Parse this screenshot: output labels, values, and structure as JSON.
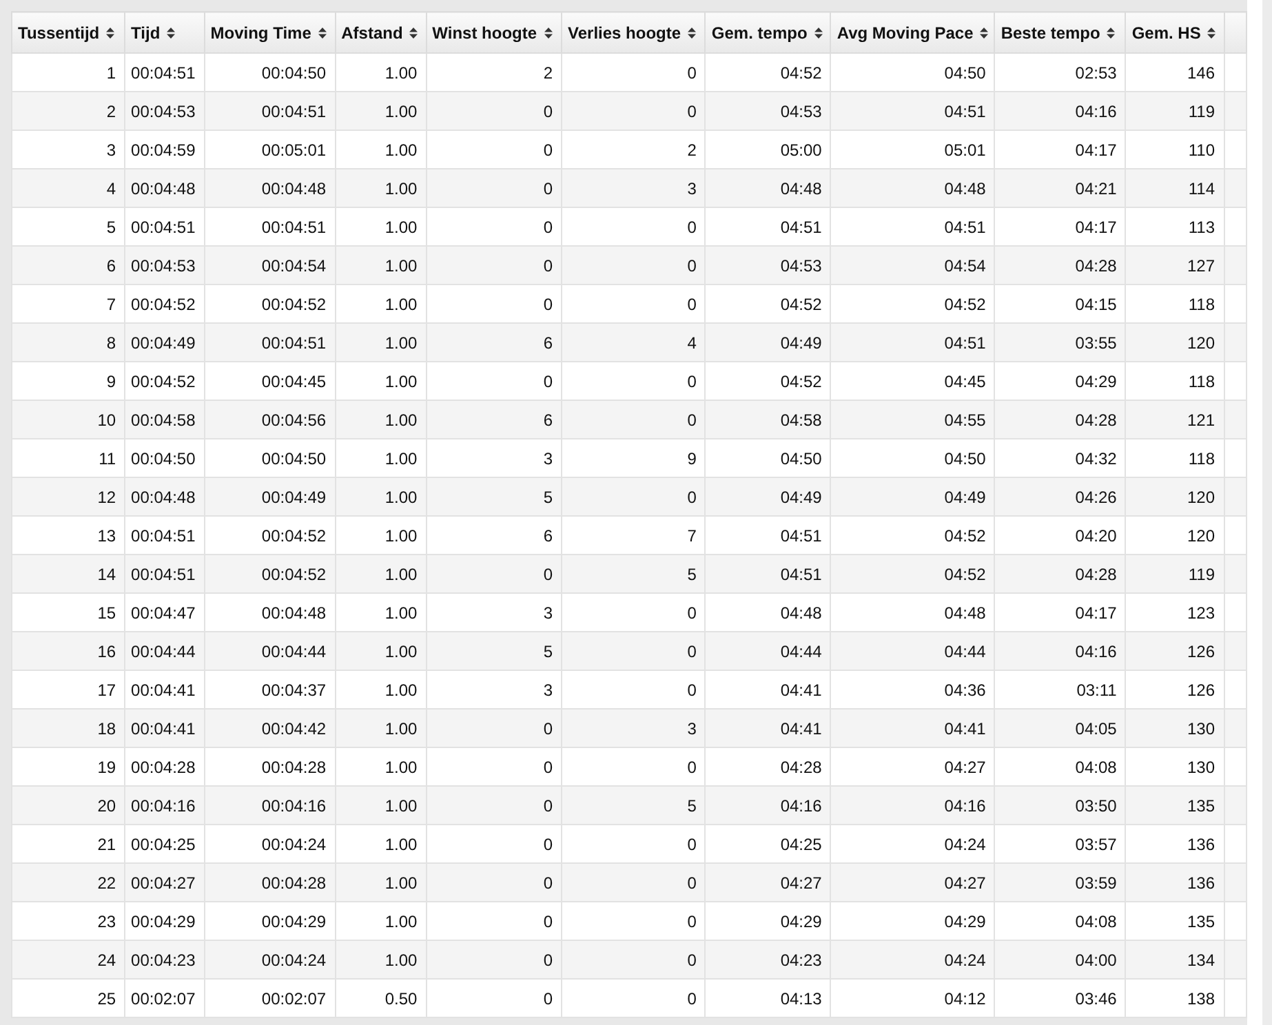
{
  "table": {
    "columns": [
      "Tussentijd",
      "Tijd",
      "Moving Time",
      "Afstand",
      "Winst hoogte",
      "Verlies hoogte",
      "Gem. tempo",
      "Avg Moving Pace",
      "Beste tempo",
      "Gem. HS"
    ],
    "rows": [
      [
        "1",
        "00:04:51",
        "00:04:50",
        "1.00",
        "2",
        "0",
        "04:52",
        "04:50",
        "02:53",
        "146"
      ],
      [
        "2",
        "00:04:53",
        "00:04:51",
        "1.00",
        "0",
        "0",
        "04:53",
        "04:51",
        "04:16",
        "119"
      ],
      [
        "3",
        "00:04:59",
        "00:05:01",
        "1.00",
        "0",
        "2",
        "05:00",
        "05:01",
        "04:17",
        "110"
      ],
      [
        "4",
        "00:04:48",
        "00:04:48",
        "1.00",
        "0",
        "3",
        "04:48",
        "04:48",
        "04:21",
        "114"
      ],
      [
        "5",
        "00:04:51",
        "00:04:51",
        "1.00",
        "0",
        "0",
        "04:51",
        "04:51",
        "04:17",
        "113"
      ],
      [
        "6",
        "00:04:53",
        "00:04:54",
        "1.00",
        "0",
        "0",
        "04:53",
        "04:54",
        "04:28",
        "127"
      ],
      [
        "7",
        "00:04:52",
        "00:04:52",
        "1.00",
        "0",
        "0",
        "04:52",
        "04:52",
        "04:15",
        "118"
      ],
      [
        "8",
        "00:04:49",
        "00:04:51",
        "1.00",
        "6",
        "4",
        "04:49",
        "04:51",
        "03:55",
        "120"
      ],
      [
        "9",
        "00:04:52",
        "00:04:45",
        "1.00",
        "0",
        "0",
        "04:52",
        "04:45",
        "04:29",
        "118"
      ],
      [
        "10",
        "00:04:58",
        "00:04:56",
        "1.00",
        "6",
        "0",
        "04:58",
        "04:55",
        "04:28",
        "121"
      ],
      [
        "11",
        "00:04:50",
        "00:04:50",
        "1.00",
        "3",
        "9",
        "04:50",
        "04:50",
        "04:32",
        "118"
      ],
      [
        "12",
        "00:04:48",
        "00:04:49",
        "1.00",
        "5",
        "0",
        "04:49",
        "04:49",
        "04:26",
        "120"
      ],
      [
        "13",
        "00:04:51",
        "00:04:52",
        "1.00",
        "6",
        "7",
        "04:51",
        "04:52",
        "04:20",
        "120"
      ],
      [
        "14",
        "00:04:51",
        "00:04:52",
        "1.00",
        "0",
        "5",
        "04:51",
        "04:52",
        "04:28",
        "119"
      ],
      [
        "15",
        "00:04:47",
        "00:04:48",
        "1.00",
        "3",
        "0",
        "04:48",
        "04:48",
        "04:17",
        "123"
      ],
      [
        "16",
        "00:04:44",
        "00:04:44",
        "1.00",
        "5",
        "0",
        "04:44",
        "04:44",
        "04:16",
        "126"
      ],
      [
        "17",
        "00:04:41",
        "00:04:37",
        "1.00",
        "3",
        "0",
        "04:41",
        "04:36",
        "03:11",
        "126"
      ],
      [
        "18",
        "00:04:41",
        "00:04:42",
        "1.00",
        "0",
        "3",
        "04:41",
        "04:41",
        "04:05",
        "130"
      ],
      [
        "19",
        "00:04:28",
        "00:04:28",
        "1.00",
        "0",
        "0",
        "04:28",
        "04:27",
        "04:08",
        "130"
      ],
      [
        "20",
        "00:04:16",
        "00:04:16",
        "1.00",
        "0",
        "5",
        "04:16",
        "04:16",
        "03:50",
        "135"
      ],
      [
        "21",
        "00:04:25",
        "00:04:24",
        "1.00",
        "0",
        "0",
        "04:25",
        "04:24",
        "03:57",
        "136"
      ],
      [
        "22",
        "00:04:27",
        "00:04:28",
        "1.00",
        "0",
        "0",
        "04:27",
        "04:27",
        "03:59",
        "136"
      ],
      [
        "23",
        "00:04:29",
        "00:04:29",
        "1.00",
        "0",
        "0",
        "04:29",
        "04:29",
        "04:08",
        "135"
      ],
      [
        "24",
        "00:04:23",
        "00:04:24",
        "1.00",
        "0",
        "0",
        "04:23",
        "04:24",
        "04:00",
        "134"
      ],
      [
        "25",
        "00:02:07",
        "00:02:07",
        "0.50",
        "0",
        "0",
        "04:13",
        "04:12",
        "03:46",
        "138"
      ]
    ]
  }
}
